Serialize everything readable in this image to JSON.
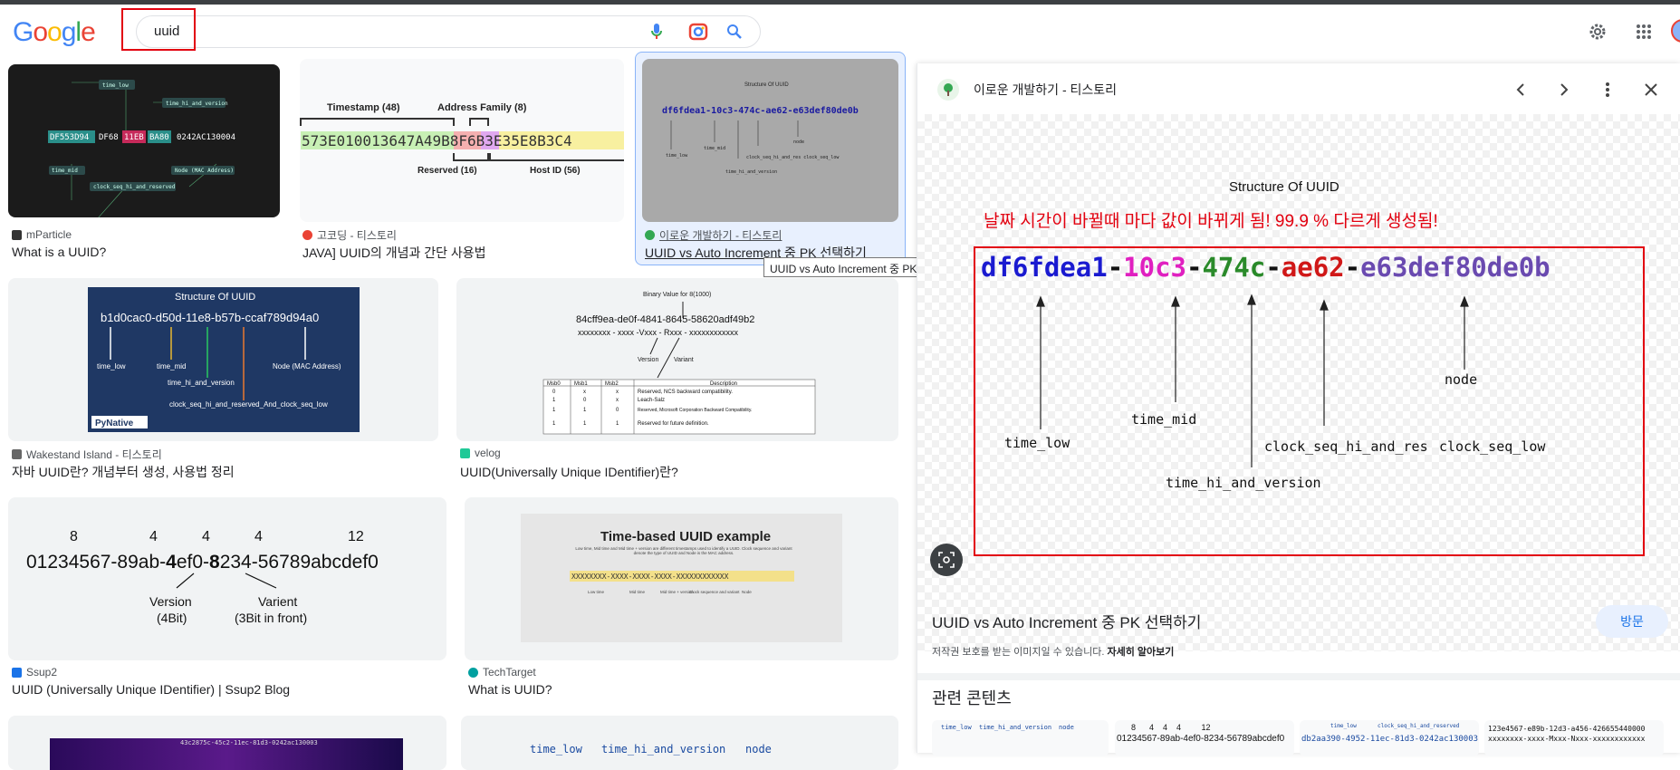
{
  "header": {
    "logo": "Google",
    "search_value": "uuid",
    "icons": [
      "mic-icon",
      "lens-icon",
      "search-icon",
      "settings-icon",
      "apps-icon",
      "avatar"
    ]
  },
  "results": [
    {
      "source": "mParticle",
      "title": "What is a UUID?",
      "thumb": {
        "seg": [
          "DF553D94",
          "DF68",
          "11EB",
          "BA80",
          "0242AC130004"
        ],
        "labels": [
          "time_low",
          "time_hi_and_version",
          "time_mid",
          "Node (MAC Address)",
          "clock_seq_hi_and_reserved"
        ]
      }
    },
    {
      "source": "고코딩 - 티스토리",
      "title": "JAVA] UUID의 개념과 간단 사용법",
      "thumb": {
        "top": [
          "Timestamp (48)",
          "Address Family (8)"
        ],
        "hex": "573E010013647A49B8F6B3E35E8B3C4",
        "bottom": [
          "Reserved (16)",
          "Host ID (56)"
        ]
      }
    },
    {
      "source": "이로운 개발하기 - 티스토리",
      "title": "UUID vs Auto Increment 중 PK 선택하기",
      "thumb": {
        "heading": "Structure Of UUID",
        "uuid": "df6fdea1-10c3-474c-ae62-e63def80de0b"
      }
    },
    {
      "source": "Wakestand Island - 티스토리",
      "title": "자바 UUID란? 개념부터 생성, 사용법 정리",
      "thumb": {
        "heading": "Structure Of UUID",
        "uuid": "b1d0cac0-d50d-11e8-b57b-ccaf789d94a0",
        "labels": [
          "time_low",
          "time_mid",
          "time_hi_and_version",
          "Node (MAC Address)",
          "clock_seq_hi_and_reserved_And_clock_seq_low"
        ],
        "brand": "PyNative"
      }
    },
    {
      "source": "velog",
      "title": "UUID(Universally Unique IDentifier)란?",
      "thumb": {
        "top": "Binary Value for 8(1000)",
        "uuid": "84cff9ea-de0f-4841-8645-58620adf49b2",
        "pattern": "xxxxxxxx - xxxx -Vxxx - Rxxx - xxxxxxxxxxxx",
        "labels": [
          "Version",
          "Variant"
        ],
        "table_head": [
          "Msb0",
          "Msb1",
          "Msb2",
          "Description"
        ],
        "table_rows": [
          [
            "0",
            "x",
            "x",
            "Reserved, NCS backward compatibility."
          ],
          [
            "1",
            "0",
            "x",
            "Leach-Salz"
          ],
          [
            "1",
            "1",
            "0",
            "Reserved, Microsoft Corporation Backward Compatibility."
          ],
          [
            "1",
            "1",
            "1",
            "Reserved for future definition."
          ]
        ]
      }
    },
    {
      "source": "Ssup2",
      "title": "UUID (Universally Unique IDentifier) | Ssup2 Blog",
      "thumb": {
        "nums": [
          "8",
          "4",
          "4",
          "4",
          "12"
        ],
        "uuid_a": "01234567-89ab-",
        "uuid_b": "4",
        "uuid_c": "ef0-",
        "uuid_d": "8",
        "uuid_e": "234-56789abcdef0",
        "labels": [
          "Version",
          "(4Bit)",
          "Varient",
          "(3Bit in front)"
        ]
      }
    },
    {
      "source": "TechTarget",
      "title": "What is UUID?",
      "thumb": {
        "heading": "Time-based UUID example",
        "desc": "Low time, Mid time and Mid time + version are different timestamps used to identify a UUID. Clock sequence and variant denote the type of UUID and Node is the MAC address.",
        "pattern": "XXXXXXXX-XXXX-XXXX-XXXX-XXXXXXXXXXXX",
        "labels": [
          "Low time",
          "Mid time",
          "Mid time + version",
          "Clock sequence and variant",
          "Node"
        ]
      }
    },
    {
      "thumb": {
        "uuid": "43c2875c-45c2-11ec-81d3-0242ac130003"
      }
    },
    {
      "thumb": {
        "labels": [
          "time_low",
          "time_hi_and_version",
          "node"
        ]
      }
    }
  ],
  "tooltip": "UUID vs Auto Increment 중 PK 선택하기",
  "panel": {
    "source": "이로운 개발하기 - 티스토리",
    "heading": "Structure  Of UUID",
    "red_note": "날짜 시간이 바뀔때 마다 값이 바뀌게 됨! 99.9 % 다르게 생성됨!",
    "uuid_parts": [
      "df6fdea1",
      "-",
      "10c3",
      "-",
      "474c",
      "-",
      "ae62",
      "-",
      "e63def80de0b"
    ],
    "labels": [
      "time_low",
      "time_mid",
      "time_hi_and_version",
      "clock_seq_hi_and_res",
      "clock_seq_low",
      "node"
    ],
    "title": "UUID vs Auto Increment 중 PK 선택하기",
    "visit": "방문",
    "copyright": "저작권 보호를 받는 이미지일 수 있습니다.",
    "learn_more": "자세히 알아보기",
    "related": "관련 콘텐츠",
    "related_thumbs": [
      {
        "labels": [
          "time_low",
          "time_hi_and_version",
          "node"
        ]
      },
      {
        "nums": "8      4    4    4         12",
        "uuid": "01234567-89ab-4ef0-8234-56789abcdef0"
      },
      {
        "labels": [
          "time_low",
          "clock_seq_hi_and_reserved"
        ],
        "uuid": "db2aa390-4952-11ec-81d3-0242ac130003"
      },
      {
        "uuid": "123e4567-e89b-12d3-a456-426655440000",
        "pattern": "xxxxxxxx-xxxx-Mxxx-Nxxx-xxxxxxxxxxxx"
      }
    ]
  },
  "colors": {
    "accent": "#1a73e8",
    "highlight": "#e2000f"
  }
}
